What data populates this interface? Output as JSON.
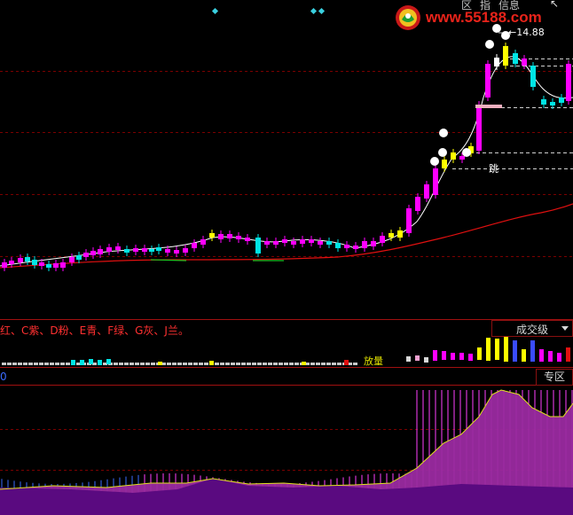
{
  "toolbar": {
    "item1_label": "区",
    "item2_label": "指",
    "item3_label": "信息",
    "arrow_glyph": "↖"
  },
  "watermark": {
    "site_text": "www.55188.com"
  },
  "main_chart": {
    "high_price_label": "←14.88",
    "jump_label": "跳",
    "colors": {
      "bull": "#ff00ff",
      "bear": "#00e5e5",
      "flat": "#ffff00",
      "ma_long": "#e01010",
      "ma_short": "#ffffff",
      "grid": "#8a0000"
    }
  },
  "color_legend": {
    "text": "红、C紫、D粉、E青、F绿、G灰、J兰。"
  },
  "volume_panel": {
    "selector_label": "成交级",
    "signal_label": "放量"
  },
  "indicator_panel": {
    "value_label": "0",
    "zone_button_label": "专区"
  }
}
